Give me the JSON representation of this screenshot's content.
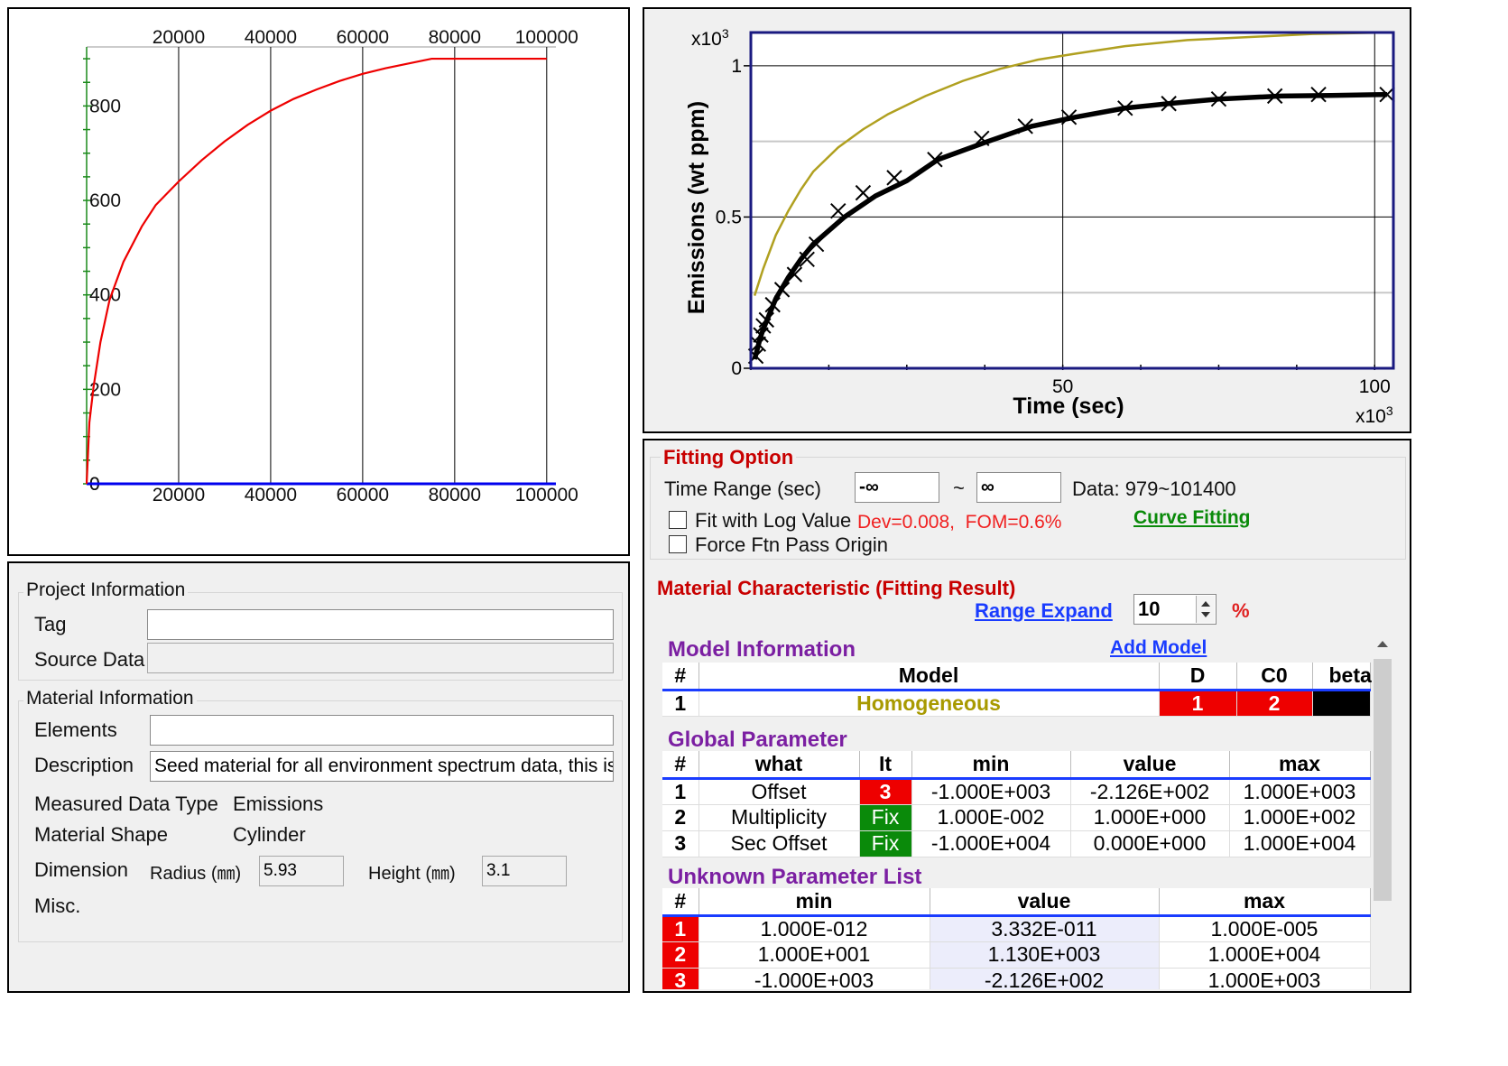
{
  "top_left_chart": {
    "type": "line",
    "x_ticks_top": [
      "20000",
      "40000",
      "60000",
      "80000",
      "100000"
    ],
    "x_ticks_bottom": [
      "20000",
      "40000",
      "60000",
      "80000",
      "100000"
    ],
    "y_ticks": [
      "0",
      "200",
      "400",
      "600",
      "800"
    ],
    "x_range": [
      0,
      102000
    ],
    "y_range": [
      0,
      925
    ],
    "grid_x": [
      20000,
      40000,
      60000,
      80000,
      100000
    ],
    "red_curve_color": "#ee0000",
    "baseline_color": "#0000ee",
    "red_series": [
      [
        0,
        0
      ],
      [
        600,
        130
      ],
      [
        1500,
        205
      ],
      [
        3000,
        300
      ],
      [
        5000,
        390
      ],
      [
        8000,
        470
      ],
      [
        12000,
        545
      ],
      [
        15000,
        590
      ],
      [
        20000,
        640
      ],
      [
        25000,
        685
      ],
      [
        30000,
        725
      ],
      [
        35000,
        760
      ],
      [
        40000,
        790
      ],
      [
        45000,
        815
      ],
      [
        50000,
        835
      ],
      [
        55000,
        853
      ],
      [
        60000,
        868
      ],
      [
        65000,
        880
      ],
      [
        70000,
        890
      ],
      [
        75000,
        900
      ],
      [
        80000,
        900
      ],
      [
        90000,
        900
      ],
      [
        100000,
        900
      ]
    ]
  },
  "top_right_chart": {
    "type": "line",
    "y_multiplier": "x10",
    "y_multiplier_exp": "3",
    "x_multiplier": "x10",
    "x_multiplier_exp": "3",
    "ylabel": "Emissions (wt ppm)",
    "xlabel": "Time (sec)",
    "y_ticks": [
      "0",
      "0.5",
      "1"
    ],
    "x_ticks": [
      "50",
      "100"
    ],
    "x_range": [
      0,
      103
    ],
    "y_range": [
      0,
      1.11
    ],
    "fit_color": "#b0a020",
    "series": [
      {
        "values": [
          [
            0.6,
            0.24
          ],
          [
            2,
            0.33
          ],
          [
            4,
            0.44
          ],
          [
            6,
            0.52
          ],
          [
            8,
            0.59
          ],
          [
            10,
            0.65
          ],
          [
            14,
            0.73
          ],
          [
            18,
            0.79
          ],
          [
            22,
            0.84
          ],
          [
            28,
            0.9
          ],
          [
            34,
            0.95
          ],
          [
            40,
            0.99
          ],
          [
            46,
            1.02
          ],
          [
            52,
            1.04
          ],
          [
            60,
            1.065
          ],
          [
            70,
            1.085
          ],
          [
            80,
            1.095
          ],
          [
            90,
            1.105
          ],
          [
            102,
            1.11
          ]
        ]
      },
      {
        "values": [
          [
            0.6,
            0.03
          ],
          [
            1,
            0.06
          ],
          [
            1.5,
            0.1
          ],
          [
            2,
            0.13
          ],
          [
            3,
            0.18
          ],
          [
            4,
            0.23
          ],
          [
            6,
            0.3
          ],
          [
            8,
            0.36
          ],
          [
            10,
            0.41
          ],
          [
            15,
            0.5
          ],
          [
            20,
            0.57
          ],
          [
            25,
            0.62
          ],
          [
            30,
            0.69
          ],
          [
            38,
            0.75
          ],
          [
            45,
            0.8
          ],
          [
            52,
            0.83
          ],
          [
            60,
            0.86
          ],
          [
            67,
            0.875
          ],
          [
            75,
            0.89
          ],
          [
            85,
            0.9
          ],
          [
            93,
            0.902
          ],
          [
            102,
            0.905
          ]
        ]
      }
    ],
    "markers": [
      [
        0.8,
        0.04
      ],
      [
        1.2,
        0.08
      ],
      [
        1.6,
        0.11
      ],
      [
        2.0,
        0.14
      ],
      [
        2.5,
        0.16
      ],
      [
        3.5,
        0.21
      ],
      [
        5,
        0.26
      ],
      [
        7,
        0.31
      ],
      [
        9,
        0.36
      ],
      [
        10.5,
        0.41
      ],
      [
        14,
        0.52
      ],
      [
        18,
        0.58
      ],
      [
        23,
        0.63
      ],
      [
        29.5,
        0.69
      ],
      [
        37,
        0.76
      ],
      [
        44,
        0.8
      ],
      [
        51,
        0.83
      ],
      [
        60,
        0.86
      ],
      [
        67,
        0.875
      ],
      [
        75,
        0.89
      ],
      [
        84,
        0.9
      ],
      [
        91,
        0.905
      ],
      [
        102,
        0.905
      ]
    ]
  },
  "project_info": {
    "title": "Project Information",
    "tag_label": "Tag",
    "tag_value": "",
    "source_label": "Source Data",
    "source_value": ""
  },
  "material_info": {
    "title": "Material Information",
    "elements_label": "Elements",
    "elements_value": "",
    "description_label": "Description",
    "description_value": "Seed material for all environment spectrum data, this is j",
    "measured_type_label": "Measured Data Type",
    "measured_type_value": "Emissions",
    "shape_label": "Material Shape",
    "shape_value": "Cylinder",
    "dimension_label": "Dimension",
    "radius_label": "Radius (㎜)",
    "radius_value": "5.93",
    "height_label": "Height (㎜)",
    "height_value": "3.1",
    "misc_label": "Misc."
  },
  "fitting_option": {
    "title": "Fitting Option",
    "time_range_label": "Time Range (sec)",
    "time_from": "-∞",
    "tilde": "~",
    "time_to": "∞",
    "data_text": "Data: 979~101400",
    "log_label": "Fit with Log Value",
    "dev_text": "Dev=0.008,  FOM=0.6%",
    "curve_fitting": "Curve Fitting",
    "origin_label": "Force Ftn Pass Origin"
  },
  "material_char": {
    "title": "Material Characteristic (Fitting Result)",
    "range_expand": "Range Expand",
    "range_value": "10",
    "percent": "%"
  },
  "model_info": {
    "title": "Model Information",
    "add_model": "Add Model",
    "headers": [
      "#",
      "Model",
      "D",
      "C0",
      "beta"
    ],
    "rows": [
      {
        "n": "1",
        "model": "Homogeneous",
        "d": "1",
        "c0": "2"
      }
    ]
  },
  "global_param": {
    "title": "Global Parameter",
    "headers": [
      "#",
      "what",
      "It",
      "min",
      "value",
      "max"
    ],
    "rows": [
      {
        "n": "1",
        "what": "Offset",
        "it": "3",
        "min": "-1.000E+003",
        "value": "-2.126E+002",
        "max": "1.000E+003"
      },
      {
        "n": "2",
        "what": "Multiplicity",
        "it": "Fix",
        "min": "1.000E-002",
        "value": "1.000E+000",
        "max": "1.000E+002"
      },
      {
        "n": "3",
        "what": "Sec Offset",
        "it": "Fix",
        "min": "-1.000E+004",
        "value": "0.000E+000",
        "max": "1.000E+004"
      }
    ]
  },
  "unknown_param": {
    "title": "Unknown Parameter List",
    "headers": [
      "#",
      "min",
      "value",
      "max"
    ],
    "rows": [
      {
        "n": "1",
        "min": "1.000E-012",
        "value": "3.332E-011",
        "max": "1.000E-005"
      },
      {
        "n": "2",
        "min": "1.000E+001",
        "value": "1.130E+003",
        "max": "1.000E+004"
      },
      {
        "n": "3",
        "min": "-1.000E+003",
        "value": "-2.126E+002",
        "max": "1.000E+003"
      }
    ]
  }
}
